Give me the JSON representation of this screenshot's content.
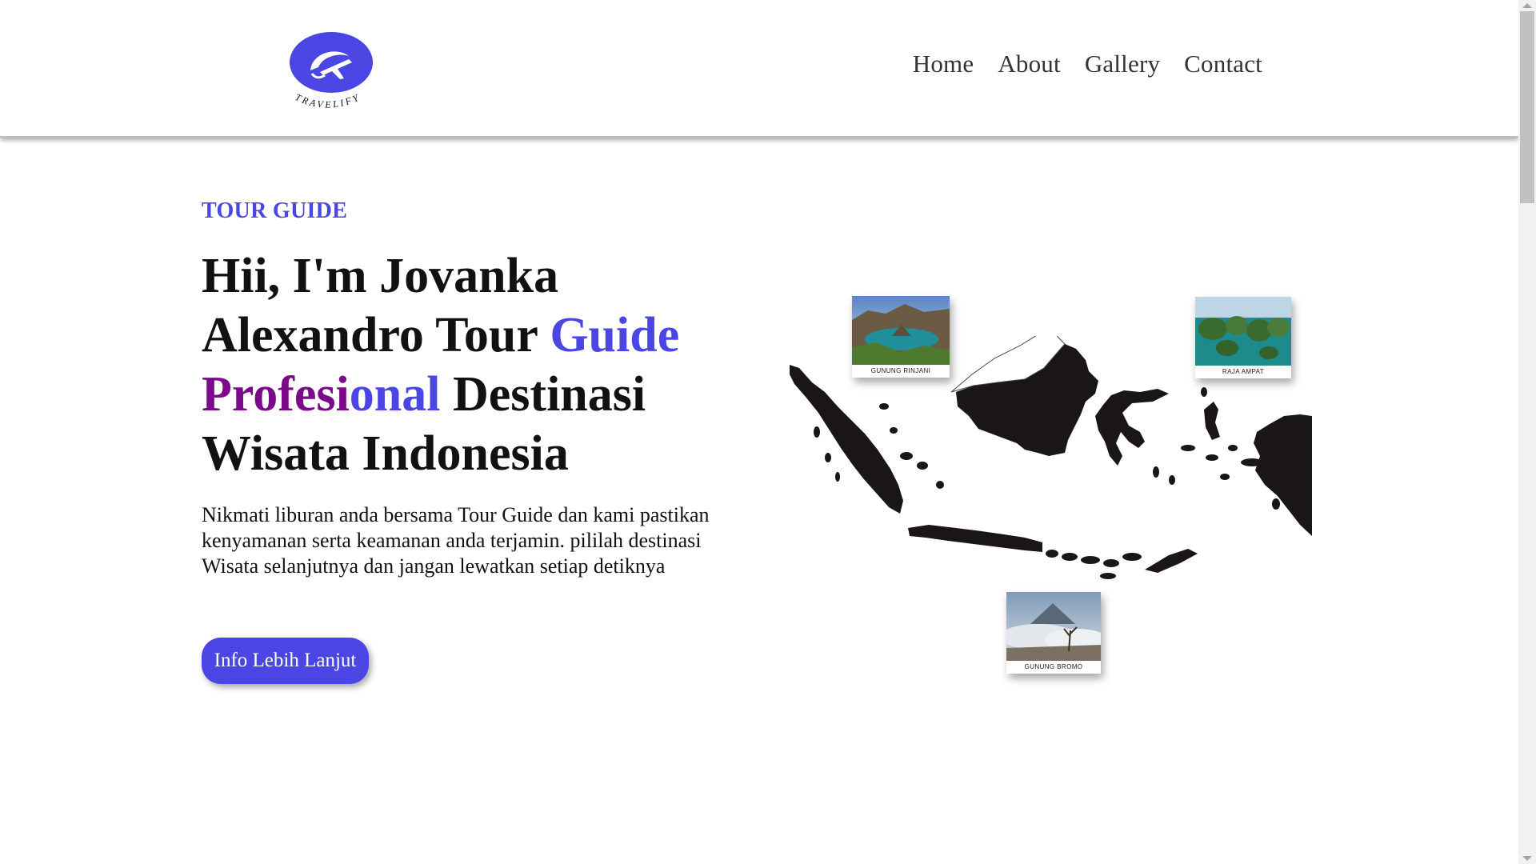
{
  "header": {
    "brand": "TRAVELIFY",
    "brand_color": "#4b46e3",
    "nav": [
      {
        "label": "Home"
      },
      {
        "label": "About"
      },
      {
        "label": "Gallery"
      },
      {
        "label": "Contact"
      }
    ]
  },
  "hero": {
    "eyebrow": "TOUR GUIDE",
    "headline_part1": "Hii, I'm Jovanka Alexandro Tour ",
    "headline_blue": "Guide",
    "headline_purple": "Profesi",
    "headline_blue2": "onal",
    "headline_part2": " Destinasi Wisata Indonesia",
    "description": "Nikmati liburan anda bersama Tour Guide dan kami pastikan kenyamanan serta keamanan anda terjamin. pililah destinasi Wisata selanjutnya dan jangan lewatkan setiap detiknya",
    "cta_label": "Info Lebih Lanjut"
  },
  "map": {
    "destinations": [
      {
        "caption": "GUNUNG RINJANI"
      },
      {
        "caption": "RAJA AMPAT"
      },
      {
        "caption": "GUNUNG BROMO"
      }
    ]
  },
  "colors": {
    "accent": "#4b46e3",
    "purple": "#7b0a8a",
    "text": "#111111"
  }
}
